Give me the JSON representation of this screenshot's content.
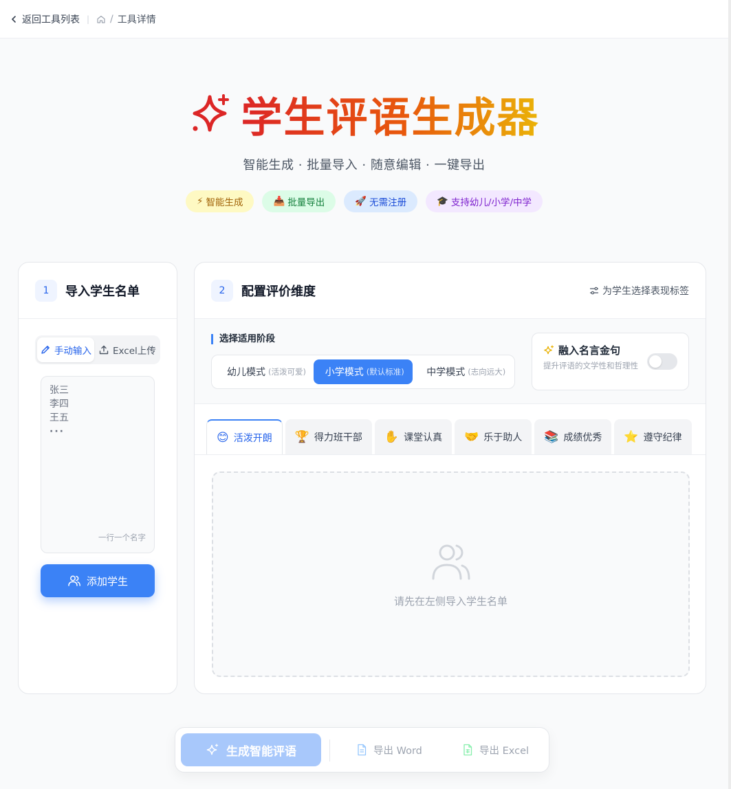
{
  "topbar": {
    "back_label": "返回工具列表",
    "breadcrumb_current": "工具详情",
    "separator": "/"
  },
  "hero": {
    "title": "学生评语生成器",
    "subtitle": "智能生成 · 批量导入 · 随意编辑 · 一键导出",
    "badges": [
      {
        "icon": "⚡",
        "label": "智能生成",
        "bg": "#fef9c3",
        "color": "#a16207"
      },
      {
        "icon": "📥",
        "label": "批量导出",
        "bg": "#dcfce7",
        "color": "#15803d"
      },
      {
        "icon": "🚀",
        "label": "无需注册",
        "bg": "#dbeafe",
        "color": "#1d4ed8"
      },
      {
        "icon": "🎓",
        "label": "支持幼儿/小学/中学",
        "bg": "#f3e8ff",
        "color": "#7e22ce"
      }
    ]
  },
  "left_panel": {
    "step": "1",
    "title": "导入学生名单",
    "mode_manual": "手动输入",
    "mode_excel": "Excel上传",
    "names_placeholder_lines": [
      "张三",
      "李四",
      "王五",
      "···"
    ],
    "names_hint": "一行一个名字",
    "add_button": "添加学生"
  },
  "right_panel": {
    "step": "2",
    "title": "配置评价维度",
    "tag_select_label": "为学生选择表现标签",
    "stage_label": "选择适用阶段",
    "stages": [
      {
        "label": "幼儿模式",
        "note": "(活泼可爱)",
        "active": false
      },
      {
        "label": "小学模式",
        "note": "(默认标准)",
        "active": true
      },
      {
        "label": "中学模式",
        "note": "(志向远大)",
        "active": false
      }
    ],
    "quote_title": "融入名言金句",
    "quote_desc": "提升评语的文学性和哲理性",
    "quote_enabled": false,
    "tabs": [
      {
        "emoji": "😊",
        "label": "活泼开朗",
        "active": true
      },
      {
        "emoji": "🏆",
        "label": "得力班干部",
        "active": false
      },
      {
        "emoji": "✋",
        "label": "课堂认真",
        "active": false
      },
      {
        "emoji": "🤝",
        "label": "乐于助人",
        "active": false
      },
      {
        "emoji": "📚",
        "label": "成绩优秀",
        "active": false
      },
      {
        "emoji": "⭐",
        "label": "遵守纪律",
        "active": false
      }
    ],
    "empty_text": "请先在左侧导入学生名单"
  },
  "actions": {
    "generate": "生成智能评语",
    "export_word": "导出 Word",
    "export_excel": "导出 Excel"
  },
  "colors": {
    "accent": "#3b82f6",
    "title_gradient_start": "#dc2626",
    "title_gradient_end": "#eab308"
  }
}
